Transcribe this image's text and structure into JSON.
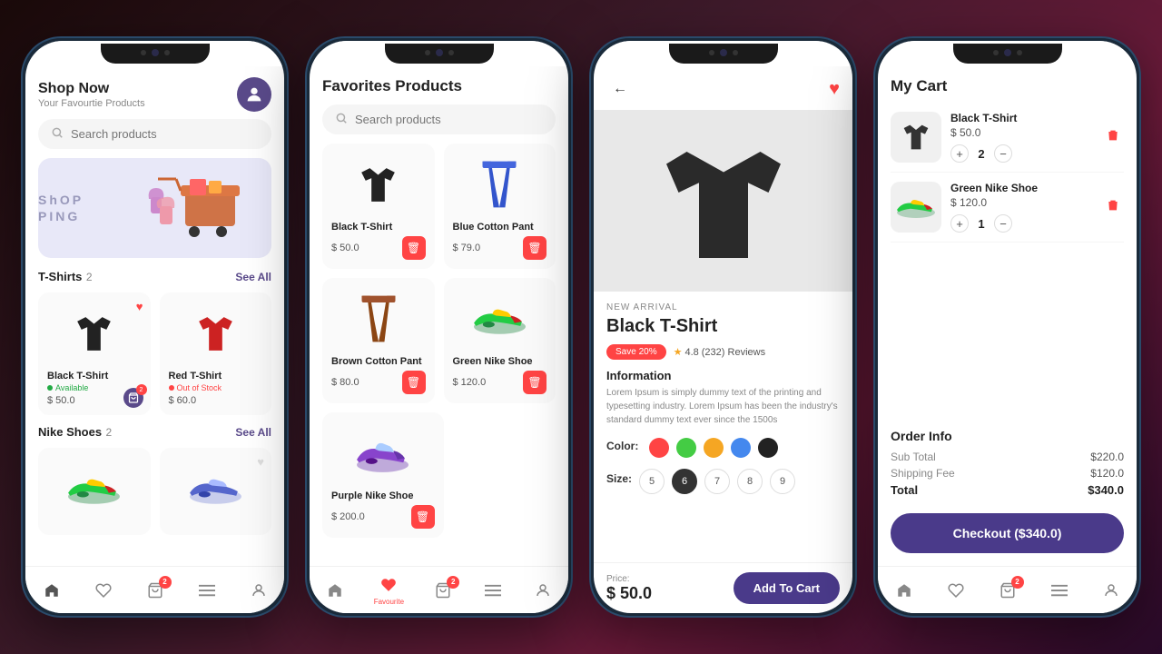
{
  "screen1": {
    "header": {
      "title": "Shop Now",
      "subtitle": "Your Favourtie Products"
    },
    "search_placeholder": "Search products",
    "banner": {
      "text_line1": "ShOP",
      "text_line2": "PING"
    },
    "sections": [
      {
        "name": "T-Shirts",
        "count": "2",
        "see_all": "See All",
        "products": [
          {
            "name": "Black T-Shirt",
            "status": "Available",
            "status_type": "available",
            "price": "$ 50.0",
            "has_heart": true,
            "color": "black"
          },
          {
            "name": "Red T-Shirt",
            "status": "Out of Stock",
            "status_type": "out",
            "price": "$ 60.0",
            "has_heart": false,
            "color": "red"
          }
        ]
      },
      {
        "name": "Nike Shoes",
        "count": "2",
        "see_all": "See All"
      }
    ],
    "nav": [
      "home",
      "heart",
      "cart",
      "menu",
      "person"
    ]
  },
  "screen2": {
    "title": "Favorites Products",
    "search_placeholder": "Search products",
    "products": [
      {
        "name": "Black T-Shirt",
        "price": "$ 50.0",
        "color": "black",
        "type": "tshirt"
      },
      {
        "name": "Blue Cotton Pant",
        "price": "$ 79.0",
        "color": "blue",
        "type": "pant"
      },
      {
        "name": "Brown Cotton Pant",
        "price": "$ 80.0",
        "color": "brown",
        "type": "pant"
      },
      {
        "name": "Green Nike Shoe",
        "price": "$ 120.0",
        "color": "green",
        "type": "shoe"
      },
      {
        "name": "Purple Nike Shoe",
        "price": "$ 200.0",
        "color": "purple",
        "type": "shoe"
      }
    ],
    "nav": [
      "home",
      "heart",
      "cart",
      "menu",
      "person"
    ],
    "active_nav": "heart",
    "cart_badge": "2"
  },
  "screen3": {
    "product": {
      "new_arrival": "NEW ARRIVAL",
      "name": "Black T-Shirt",
      "save_badge": "Save 20%",
      "rating": "4.8",
      "review_count": "232",
      "review_label": "Reviews",
      "info_title": "Information",
      "info_text": "Lorem Ipsum is simply dummy text of the printing and typesetting industry. Lorem Ipsum has been the industry's standard dummy text ever since the 1500s",
      "color_label": "Color:",
      "colors": [
        "#ff4444",
        "#44cc44",
        "#f5a623",
        "#4488ee",
        "#222222"
      ],
      "size_label": "Size:",
      "sizes": [
        "5",
        "6",
        "7",
        "8",
        "9"
      ],
      "active_size": "6",
      "price_label": "Price:",
      "price": "$ 50.0",
      "add_cart": "Add To Cart"
    }
  },
  "screen4": {
    "title": "My Cart",
    "items": [
      {
        "name": "Black T-Shirt",
        "price": "$ 50.0",
        "qty": "2",
        "color": "black",
        "type": "tshirt"
      },
      {
        "name": "Green Nike Shoe",
        "price": "$ 120.0",
        "qty": "1",
        "color": "green",
        "type": "shoe"
      }
    ],
    "order": {
      "title": "Order Info",
      "subtotal_label": "Sub Total",
      "subtotal_value": "$220.0",
      "shipping_label": "Shipping Fee",
      "shipping_value": "$120.0",
      "total_label": "Total",
      "total_value": "$340.0"
    },
    "checkout_label": "Checkout ($340.0)",
    "cart_badge": "2"
  }
}
